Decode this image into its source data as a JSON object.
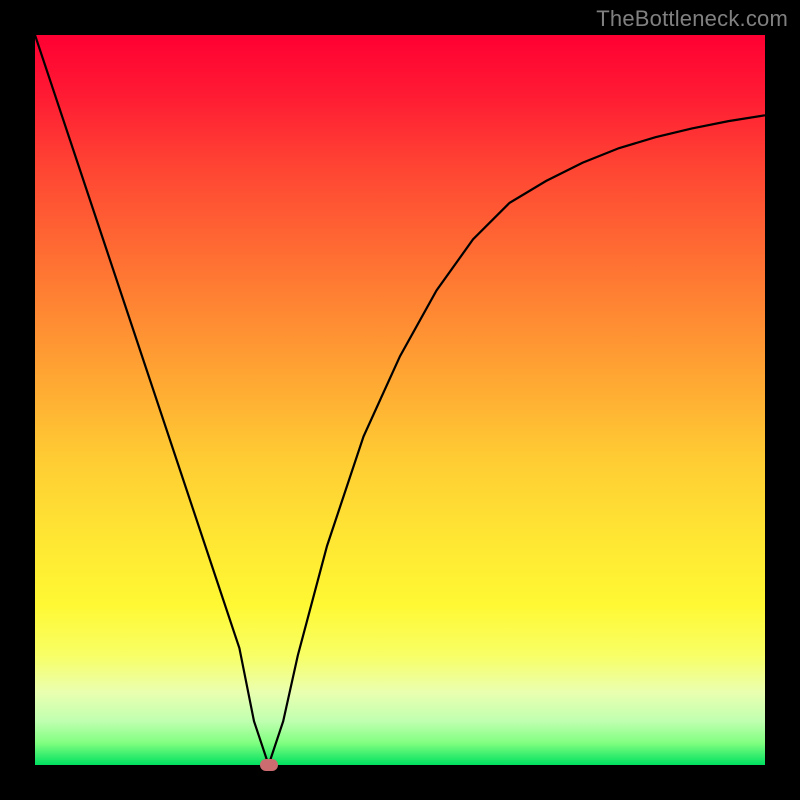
{
  "watermark": "TheBottleneck.com",
  "chart_data": {
    "type": "line",
    "title": "",
    "xlabel": "",
    "ylabel": "",
    "xlim": [
      0,
      100
    ],
    "ylim": [
      0,
      100
    ],
    "series": [
      {
        "name": "bottleneck-curve",
        "x": [
          0,
          5,
          10,
          15,
          20,
          25,
          28,
          30,
          32,
          34,
          36,
          40,
          45,
          50,
          55,
          60,
          65,
          70,
          75,
          80,
          85,
          90,
          95,
          100
        ],
        "values": [
          100,
          85,
          70,
          55,
          40,
          25,
          16,
          6,
          0,
          6,
          15,
          30,
          45,
          56,
          65,
          72,
          77,
          80,
          82.5,
          84.5,
          86,
          87.2,
          88.2,
          89
        ]
      }
    ],
    "annotations": [
      {
        "name": "min-marker",
        "x": 32,
        "y": 0
      }
    ]
  },
  "colors": {
    "curve": "#000000",
    "marker": "#cc6b70",
    "frame": "#000000"
  }
}
